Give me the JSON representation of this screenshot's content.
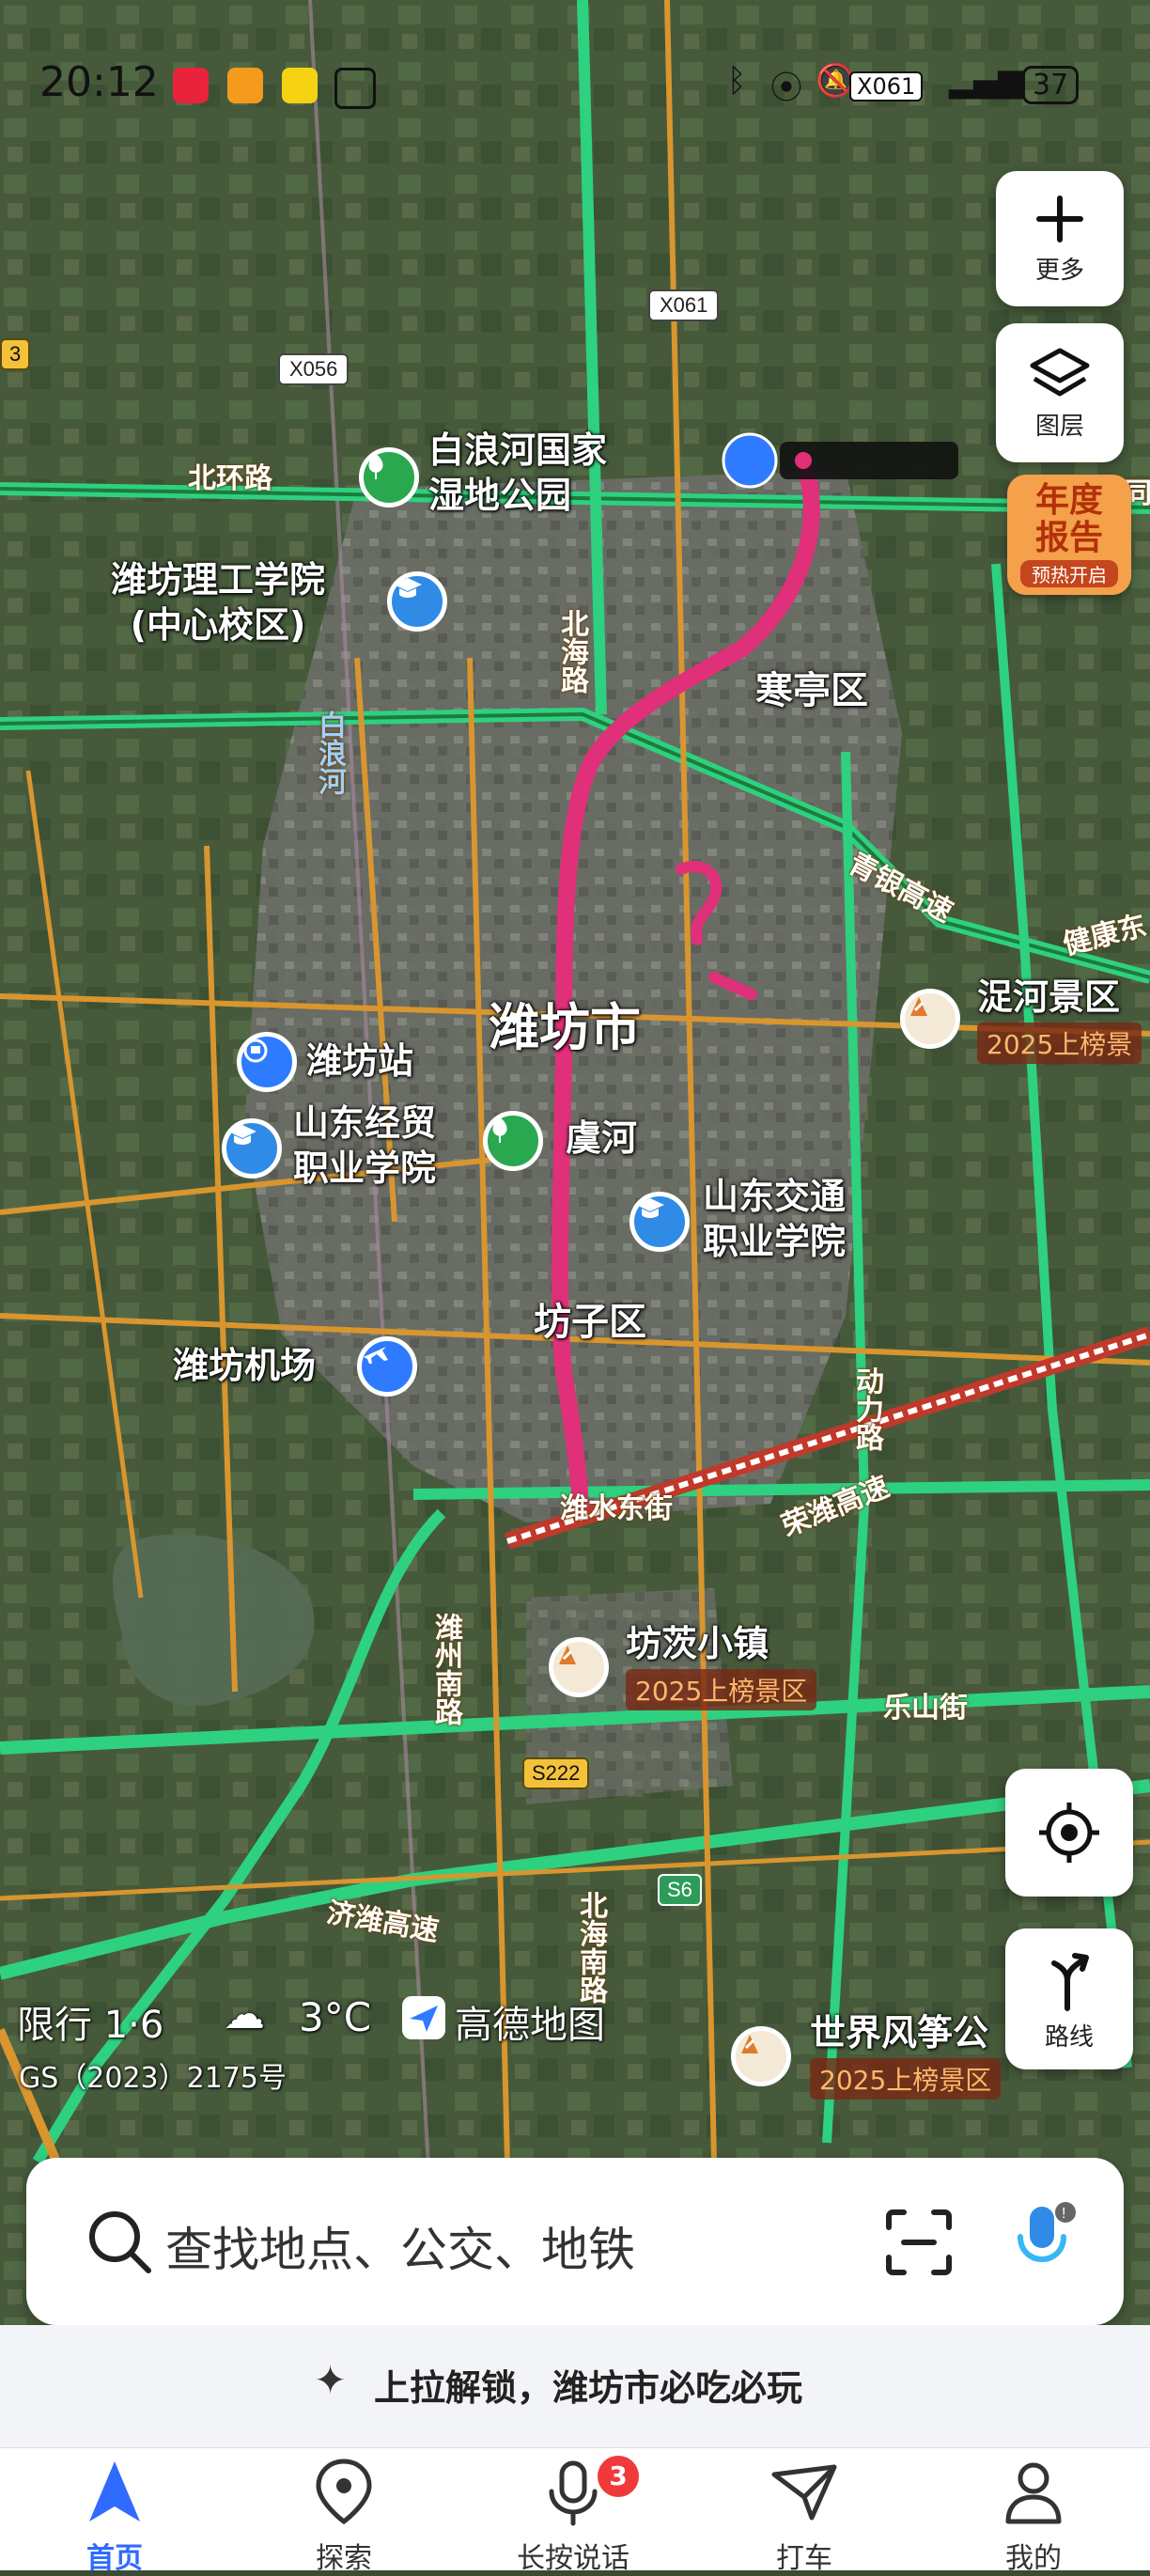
{
  "status_bar": {
    "time": "20:12",
    "battery": "37",
    "network": "X061"
  },
  "map": {
    "roads": {
      "x056": "X056",
      "x061": "X061",
      "s222": "S222",
      "s6": "S6",
      "left_edge_shield": "3",
      "beihuan": "北环路",
      "beihai": "北海路",
      "beihai_south": "北海南路",
      "bailang_river": "白浪河",
      "qingyin": "青银高速",
      "jiankang": "健康东",
      "weishui": "潍水东街",
      "rongwei": "荣潍高速",
      "weizhou_south": "潍州南路",
      "dongli": "动力路",
      "leshan": "乐山街",
      "jiwei": "济潍高速",
      "right_edge": "同"
    },
    "places": {
      "bailanghe_park": "白浪河国家\n湿地公园",
      "weifang_tech": "潍坊理工学院\n(中心校区)",
      "hanting": "寒亭区",
      "weifang_city": "潍坊市",
      "weifang_station": "潍坊站",
      "sd_economy": "山东经贸\n职业学院",
      "yuhe": "虞河",
      "sd_transport": "山东交通\n职业学院",
      "fangzi": "坊子区",
      "weifang_airport": "潍坊机场",
      "nihe_scenic": "浞河景区",
      "fangcha_town": "坊茨小镇",
      "kite_world": "世界风筝公"
    },
    "badges": {
      "nihe": "2025上榜景",
      "fangcha": "2025上榜景区",
      "kite": "2025上榜景区"
    },
    "overlay": {
      "restriction": "限行 1·6",
      "temperature": "3°C",
      "brand": "高德地图",
      "license": "GS（2023）2175号"
    }
  },
  "controls": {
    "more": "更多",
    "layers": "图层",
    "report_line1": "年度",
    "report_line2": "报告",
    "report_tag": "预热开启",
    "route": "路线"
  },
  "search": {
    "placeholder": "查找地点、公交、地铁"
  },
  "promo": {
    "text": "上拉解锁，潍坊市必吃必玩"
  },
  "tabs": [
    {
      "label": "首页",
      "icon": "navigate-arrow-icon",
      "active": true
    },
    {
      "label": "探索",
      "icon": "location-pin-icon"
    },
    {
      "label": "长按说话",
      "icon": "microphone-icon",
      "badge": "3"
    },
    {
      "label": "打车",
      "icon": "taxi-icon"
    },
    {
      "label": "我的",
      "icon": "person-icon"
    }
  ],
  "colors": {
    "accent": "#2f6bff",
    "route_pink": "#e0307a",
    "highway": "#3ed38a",
    "arterial": "#d9952e"
  }
}
